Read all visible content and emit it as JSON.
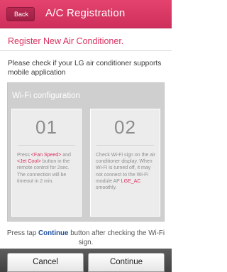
{
  "header": {
    "back_label": "Back",
    "title": "A/C Registration"
  },
  "subtitle": "Register New Air Conditioner.",
  "description": "Please check if your LG air conditioner supports mobile application",
  "panel": {
    "title": "Wi-Fi configuration",
    "cards": [
      {
        "number": "01",
        "parts": [
          {
            "text": "Press ",
            "highlight": false
          },
          {
            "text": "<Fan Speed>",
            "highlight": true
          },
          {
            "text": " and ",
            "highlight": false
          },
          {
            "text": "<Jet Cool>",
            "highlight": true
          },
          {
            "text": " button in the remote control for 2sec. The connection will be timeout in 2 min.",
            "highlight": false
          }
        ]
      },
      {
        "number": "02",
        "parts": [
          {
            "text": "Check Wi-Fi sign on the air conditioner display. When Wi-Fi is turned off, it may not connect to the Wi-Fi module AP ",
            "highlight": false
          },
          {
            "text": "LGE_AC",
            "highlight": true
          },
          {
            "text": " smoothly.",
            "highlight": false
          }
        ]
      }
    ]
  },
  "note": {
    "before": "Press tap ",
    "emphasis": "Continue",
    "after": " button after checking the Wi-Fi sign."
  },
  "footer": {
    "cancel_label": "Cancel",
    "continue_label": "Continue"
  },
  "colors": {
    "accent": "#d9315f",
    "header_bg": "#d93a65",
    "note_emphasis": "#1e4f9e",
    "panel_bg": "#cfcfcf",
    "footer_bg": "#4d4d4d"
  }
}
